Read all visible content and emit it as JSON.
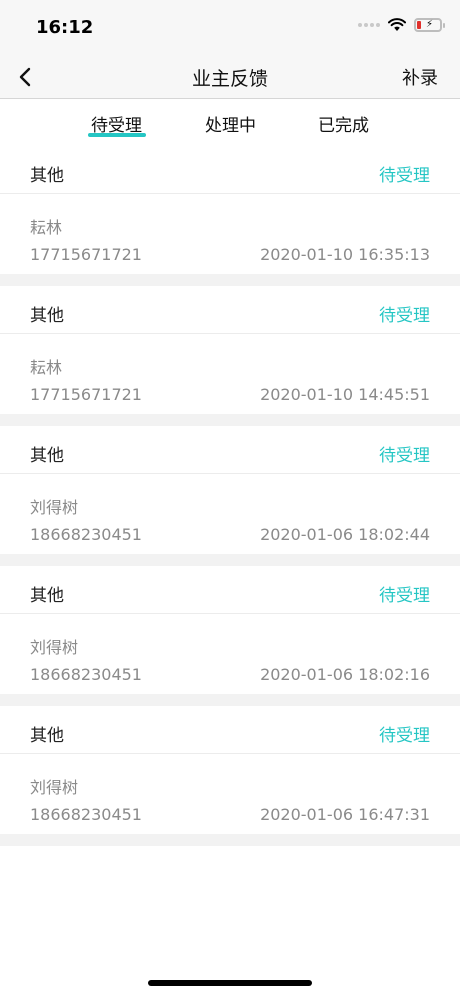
{
  "status_bar": {
    "time": "16:12",
    "battery_level": 0.2
  },
  "nav": {
    "title": "业主反馈",
    "right_action": "补录"
  },
  "tabs": [
    {
      "label": "待受理",
      "active": true
    },
    {
      "label": "处理中",
      "active": false
    },
    {
      "label": "已完成",
      "active": false
    }
  ],
  "accent_color": "#25c6c4",
  "records": [
    {
      "type": "其他",
      "status": "待受理",
      "name": "耘林",
      "phone": "17715671721",
      "time": "2020-01-10 16:35:13"
    },
    {
      "type": "其他",
      "status": "待受理",
      "name": "耘林",
      "phone": "17715671721",
      "time": "2020-01-10 14:45:51"
    },
    {
      "type": "其他",
      "status": "待受理",
      "name": "刘得树",
      "phone": "18668230451",
      "time": "2020-01-06 18:02:44"
    },
    {
      "type": "其他",
      "status": "待受理",
      "name": "刘得树",
      "phone": "18668230451",
      "time": "2020-01-06 18:02:16"
    },
    {
      "type": "其他",
      "status": "待受理",
      "name": "刘得树",
      "phone": "18668230451",
      "time": "2020-01-06 16:47:31"
    }
  ]
}
